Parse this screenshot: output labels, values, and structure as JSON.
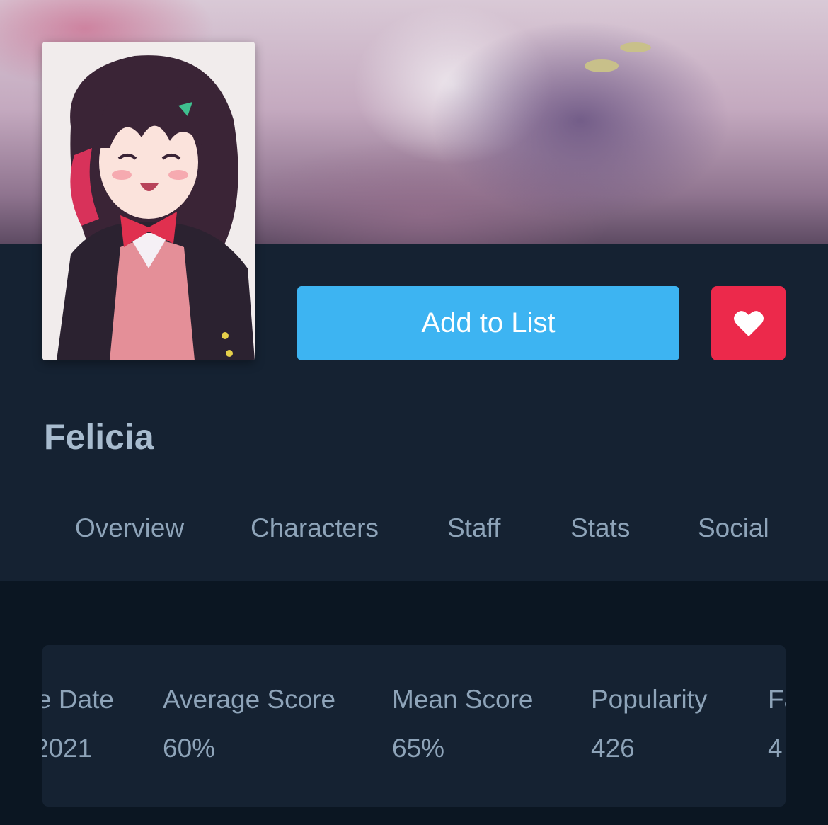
{
  "media": {
    "title": "Felicia"
  },
  "actions": {
    "add_to_list_label": "Add to List",
    "favourite_icon": "heart-icon"
  },
  "tabs": [
    {
      "label": "Overview"
    },
    {
      "label": "Characters"
    },
    {
      "label": "Staff"
    },
    {
      "label": "Stats"
    },
    {
      "label": "Social"
    }
  ],
  "stats": [
    {
      "label": "e Date",
      "value": "2021"
    },
    {
      "label": "Average Score",
      "value": "60%"
    },
    {
      "label": "Mean Score",
      "value": "65%"
    },
    {
      "label": "Popularity",
      "value": "426"
    },
    {
      "label": "Fa",
      "value": "4"
    }
  ],
  "colors": {
    "accent_blue": "#3db4f2",
    "favourite_red": "#ec294b",
    "panel_bg": "#152232",
    "page_bg": "#0b1622",
    "text_muted": "#8ea4b9",
    "title_text": "#a8bccf"
  }
}
